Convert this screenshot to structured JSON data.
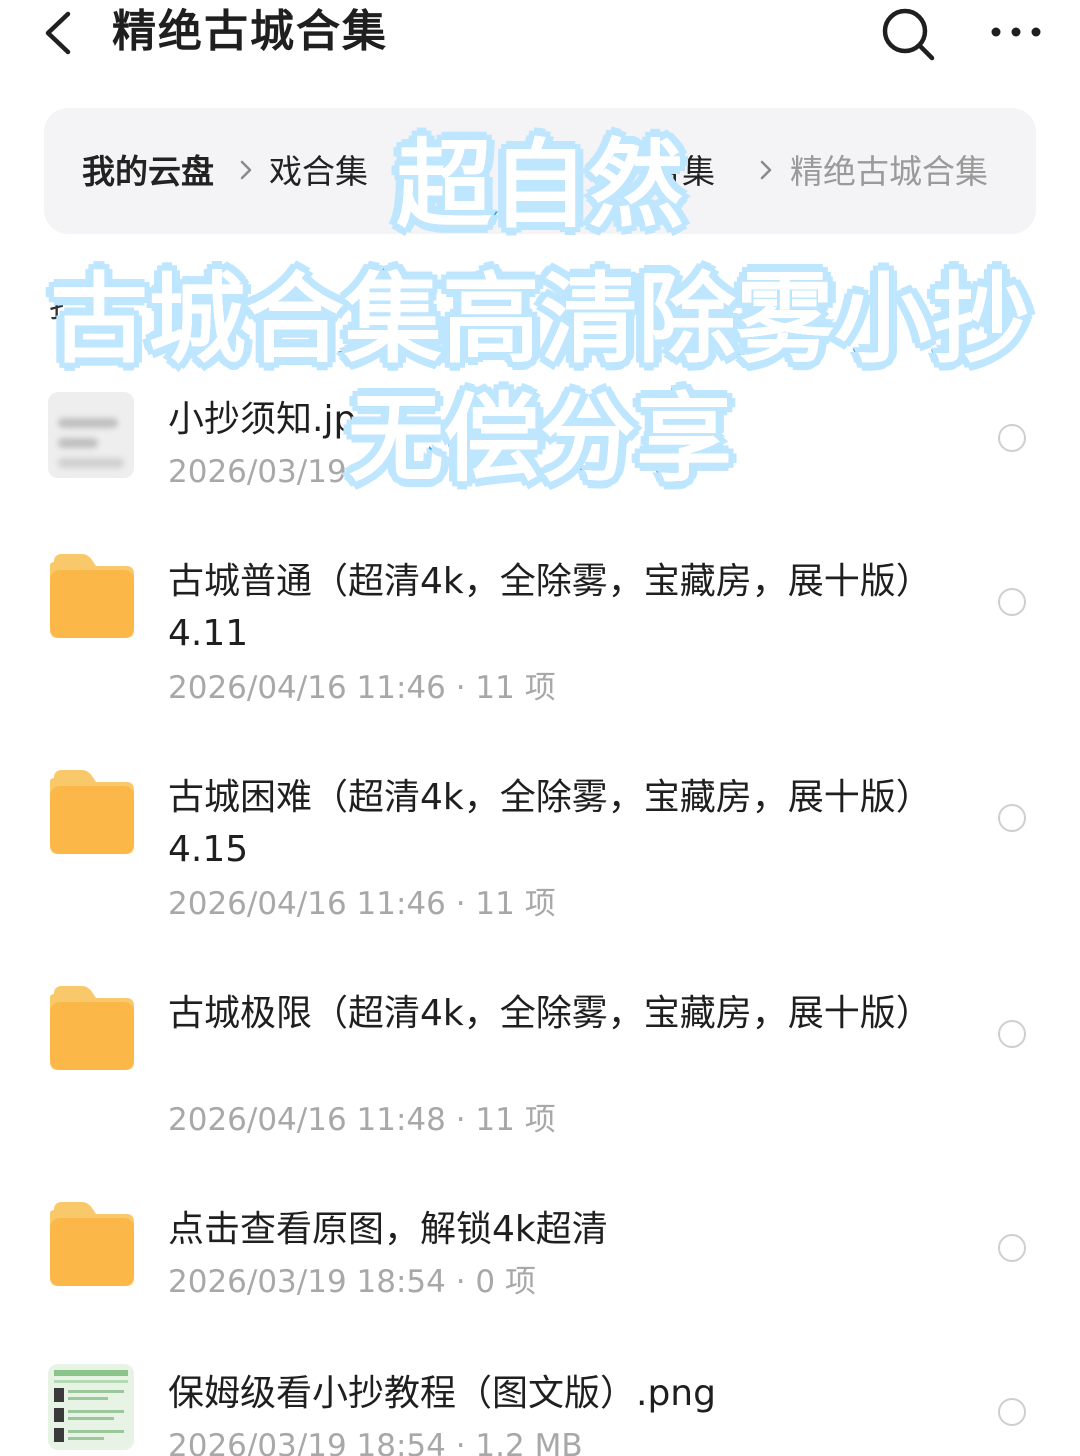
{
  "header": {
    "title": "精绝古城合集",
    "back_icon": "chevron-left-icon",
    "search_icon": "search-icon",
    "more_icon": "more-horizontal-icon"
  },
  "breadcrumb": {
    "items": [
      "我的云盘",
      "戏合集",
      "合集",
      "精绝古城合集"
    ]
  },
  "sort_label": "扌",
  "overlay": {
    "line1": "超自然",
    "line2": "古城合集高清除雾小抄",
    "line3": "无偿分享",
    "stroke_color": "#2ea6ee",
    "glow_color": "#bfe6ff"
  },
  "files": [
    {
      "name": "小抄须知.jp",
      "meta": "2026/03/19",
      "icon": "blurred-image-thumbnail"
    },
    {
      "name": "古城普通（超清4k，全除雾，宝藏房，展十版）4.11",
      "meta": "2026/04/16 11:46 · 11 项",
      "icon": "folder-icon"
    },
    {
      "name": "古城困难（超清4k，全除雾，宝藏房，展十版）4.15",
      "meta": "2026/04/16 11:46 · 11 项",
      "icon": "folder-icon"
    },
    {
      "name": "古城极限（超清4k，全除雾，宝藏房，展十版）",
      "meta": "2026/04/16 11:48 · 11 项",
      "icon": "folder-icon"
    },
    {
      "name": "点击查看原图，解锁4k超清",
      "meta": "2026/03/19 18:54 · 0 项",
      "icon": "folder-icon"
    },
    {
      "name": "保姆级看小抄教程（图文版）.png",
      "meta": "2026/03/19 18:54 · 1.2 MB",
      "icon": "image-thumbnail"
    }
  ],
  "colors": {
    "folder": "#fbb748",
    "folder_tab": "#f9c86a",
    "meta_text": "#a8a8a8",
    "breadcrumb_bg": "#f4f4f6"
  }
}
